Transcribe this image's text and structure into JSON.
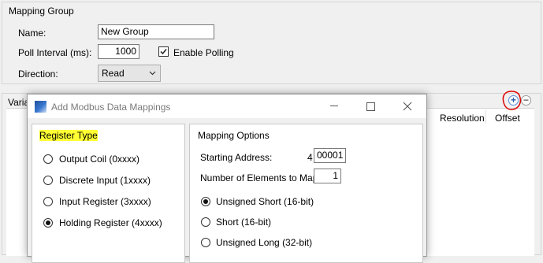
{
  "mapping_group": {
    "title": "Mapping Group",
    "name_label": "Name:",
    "name_value": "New Group",
    "poll_label": "Poll Interval (ms):",
    "poll_value": "1000",
    "enable_polling_label": "Enable Polling",
    "enable_polling_checked": true,
    "direction_label": "Direction:",
    "direction_value": "Read"
  },
  "variables": {
    "title_fragment": "Varia",
    "columns": [
      "Resolution",
      "Offset"
    ],
    "add_icon": "plus-circle-icon",
    "remove_icon": "minus-circle-icon"
  },
  "dialog": {
    "title": "Add Modbus Data Mappings",
    "register_type": {
      "title": "Register Type",
      "highlight_color": "#ffff33",
      "options": [
        {
          "label": "Output Coil (0xxxx)",
          "selected": false
        },
        {
          "label": "Discrete Input (1xxxx)",
          "selected": false
        },
        {
          "label": "Input Register (3xxxx)",
          "selected": false
        },
        {
          "label": "Holding Register (4xxxx)",
          "selected": true
        }
      ]
    },
    "mapping_options": {
      "title": "Mapping Options",
      "starting_address_label": "Starting Address:",
      "address_prefix": "4",
      "starting_address_value": "00001",
      "num_elements_label": "Number of Elements to Map:",
      "num_elements_value": "1",
      "data_types": [
        {
          "label": "Unsigned Short (16-bit)",
          "selected": true
        },
        {
          "label": "Short (16-bit)",
          "selected": false
        },
        {
          "label": "Unsigned Long (32-bit)",
          "selected": false
        }
      ]
    }
  },
  "annotation_color": "#e00000"
}
